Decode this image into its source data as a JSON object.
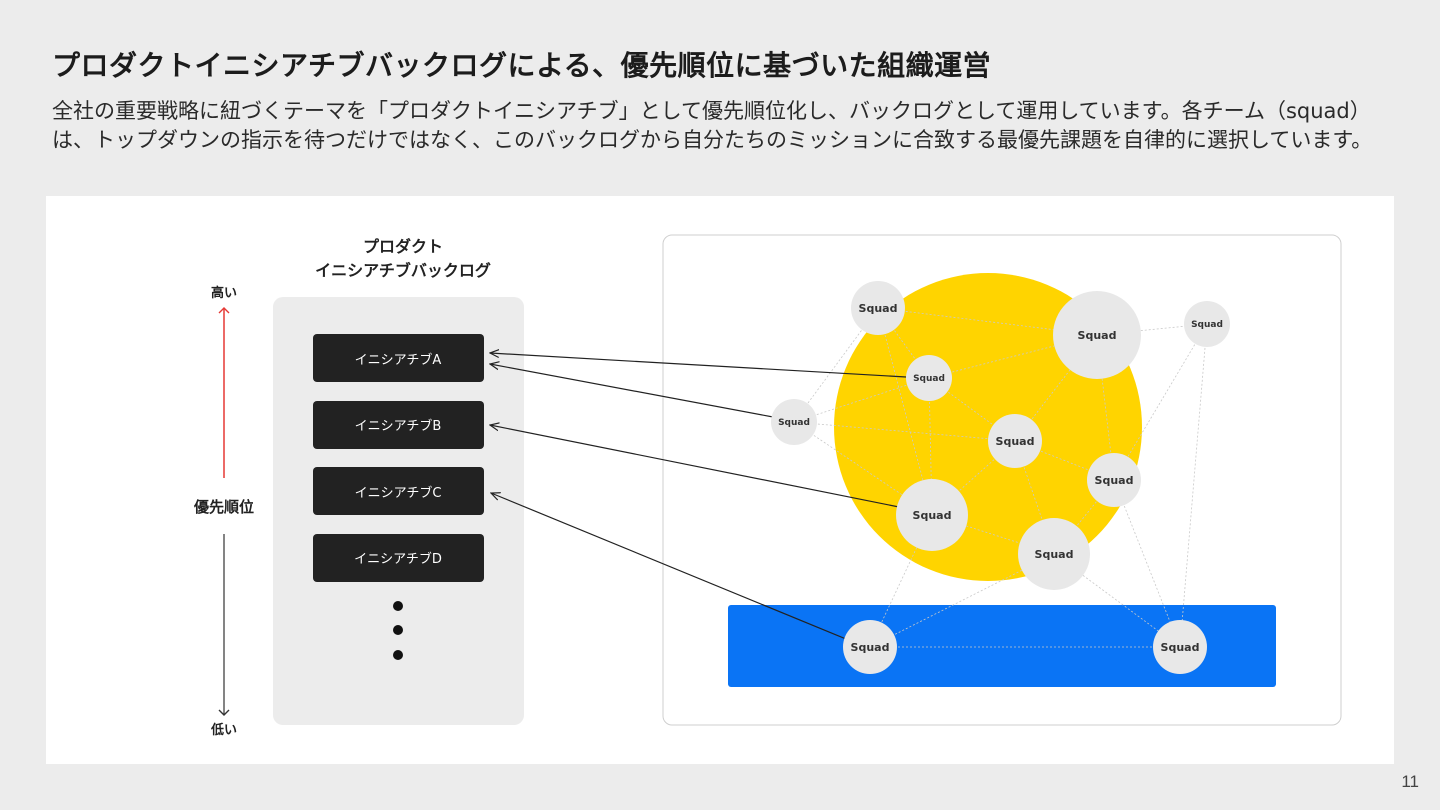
{
  "title": "プロダクトイニシアチブバックログによる、優先順位に基づいた組織運営",
  "description": "全社の重要戦略に紐づくテーマを「プロダクトイニシアチブ」として優先順位化し、バックログとして運用しています。各チーム（squad）は、トップダウンの指示を待つだけではなく、このバックログから自分たちのミッションに合致する最優先課題を自律的に選択しています。",
  "diagram": {
    "priority_axis": {
      "high": "高い",
      "label": "優先順位",
      "low": "低い"
    },
    "backlog": {
      "title_line1": "プロダクト",
      "title_line2": "イニシアチブバックログ",
      "items": [
        "イニシアチブA",
        "イニシアチブB",
        "イニシアチブC",
        "イニシアチブD"
      ]
    },
    "squad_label": "Squad",
    "colors": {
      "yellow_circle": "#FFD400",
      "blue_bar": "#0A74F5",
      "squad_node": "#E8E8E8",
      "initiative_box": "#222222",
      "high_arrow": "#E53935"
    }
  },
  "page_number": "11"
}
